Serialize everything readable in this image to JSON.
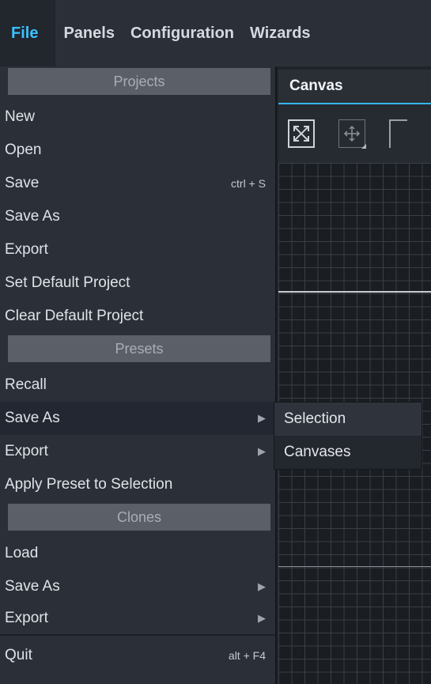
{
  "menubar": {
    "items": [
      "File",
      "Panels",
      "Configuration",
      "Wizards"
    ]
  },
  "canvas": {
    "tab_label": "Canvas",
    "tools": [
      "fit-view-icon",
      "move-icon",
      "crop-icon"
    ]
  },
  "file_menu": {
    "sections": {
      "projects": "Projects",
      "presets": "Presets",
      "clones": "Clones"
    },
    "projects_items": [
      {
        "label": "New"
      },
      {
        "label": "Open"
      },
      {
        "label": "Save",
        "shortcut": "ctrl + S"
      },
      {
        "label": "Save As"
      },
      {
        "label": "Export"
      },
      {
        "label": "Set Default Project"
      },
      {
        "label": "Clear Default Project"
      }
    ],
    "presets_items": [
      {
        "label": "Recall"
      },
      {
        "label": "Save As"
      },
      {
        "label": "Export"
      },
      {
        "label": "Apply Preset to Selection"
      }
    ],
    "clones_items": [
      {
        "label": "Load"
      },
      {
        "label": "Save As"
      },
      {
        "label": "Export"
      }
    ],
    "quit": {
      "label": "Quit",
      "shortcut": "alt + F4"
    },
    "submenu_arrow": "▶"
  },
  "submenu": {
    "items": [
      "Selection",
      "Canvases"
    ]
  },
  "colors": {
    "accent": "#39c2ff",
    "menu_bg": "#2b3038",
    "section_header": "#5b6068"
  }
}
